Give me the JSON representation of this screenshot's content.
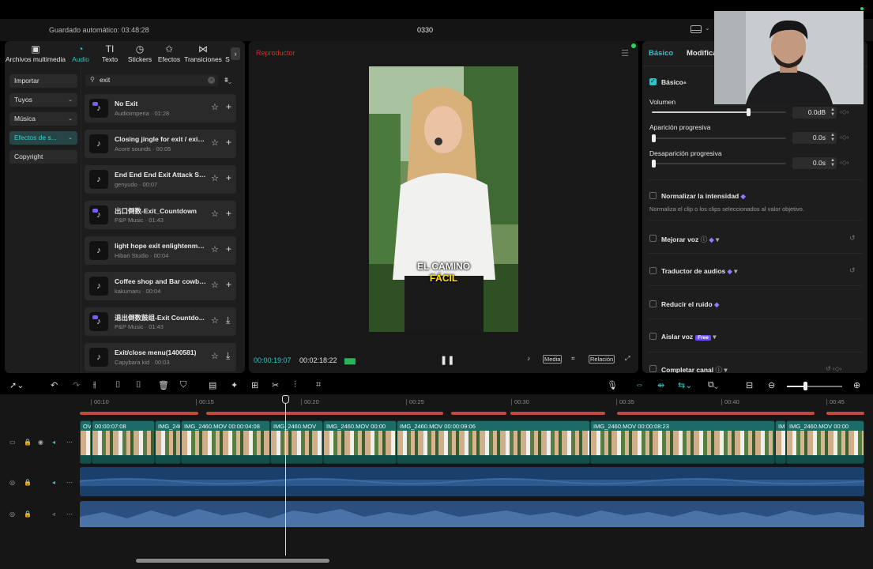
{
  "appbar": {
    "autosave": "Guardado automático: 03:48:28",
    "project": "0330"
  },
  "left_tabs": [
    {
      "label": "Archivos multimedia",
      "icon": "media-icon",
      "glyph": "▣"
    },
    {
      "label": "Audio",
      "icon": "audio-icon",
      "glyph": "◔"
    },
    {
      "label": "Texto",
      "icon": "text-icon",
      "glyph": "T͟I"
    },
    {
      "label": "Stickers",
      "icon": "sticker-icon",
      "glyph": "◷"
    },
    {
      "label": "Efectos",
      "icon": "effects-icon",
      "glyph": "✩"
    },
    {
      "label": "Transiciones",
      "icon": "transitions-icon",
      "glyph": "⋈"
    },
    {
      "label": "S",
      "icon": "more-tabs-icon",
      "glyph": ""
    }
  ],
  "categories": [
    {
      "label": "Importar",
      "caret": ""
    },
    {
      "label": "Tuyos",
      "caret": "⌄"
    },
    {
      "label": "Música",
      "caret": "⌄"
    },
    {
      "label": "Efectos de s...",
      "caret": "⌄"
    },
    {
      "label": "Copyright",
      "caret": ""
    }
  ],
  "search": {
    "value": "exit"
  },
  "tracks": [
    {
      "title": "No Exit",
      "meta": "Audioimperia · 01:28",
      "lib": true,
      "action": "+"
    },
    {
      "title": "Closing jingle for exit / exit(...",
      "meta": "Acore sounds · 00:05",
      "lib": false,
      "action": "+"
    },
    {
      "title": "End End End Exit Attack Sc...",
      "meta": "genyudo · 00:07",
      "lib": false,
      "action": "+"
    },
    {
      "title": "出口倒数-Exit_Countdown",
      "meta": "P&P Music · 01:43",
      "lib": true,
      "action": "+"
    },
    {
      "title": "light hope exit enlightenme...",
      "meta": "Hibari Studio · 00:04",
      "lib": false,
      "action": "+"
    },
    {
      "title": "Coffee shop and Bar cowbe...",
      "meta": "kakumaru · 00:04",
      "lib": false,
      "action": "+"
    },
    {
      "title": "退出倒数鼓组-Exit Countdo...",
      "meta": "P&P Music · 01:43",
      "lib": true,
      "action": "⤓"
    },
    {
      "title": "Exit/close menu(1400581)",
      "meta": "Capybara kid · 00:03",
      "lib": false,
      "action": "⤓"
    }
  ],
  "player": {
    "title": "Reproductor",
    "caption1": "EL CAMINO",
    "caption2": "FÁCIL",
    "current": "00:00:19:07",
    "total": "00:02:18:22",
    "media_btn": "Media",
    "ratio_btn": "Relación"
  },
  "right": {
    "tab_basic": "Básico",
    "tab_modify": "Modifica",
    "section": "Básico",
    "volume_label": "Volumen",
    "volume_value": "0.0dB",
    "volume_level": 0.72,
    "fadein_label": "Aparición progresiva",
    "fadein_value": "0.0s",
    "fadeout_label": "Desaparición progresiva",
    "fadeout_value": "0.0s",
    "normalize_label": "Normalizar la intensidad",
    "normalize_desc": "Normaliza el clip o los clips seleccionados al valor objetivo.",
    "enhance_label": "Mejorar voz",
    "translate_label": "Traductor de audios",
    "noise_label": "Reducir el ruido",
    "isolate_label": "Aislar voz",
    "free_badge": "Free",
    "channel_label": "Completar canal"
  },
  "timeline": {
    "ticks": [
      "00:10",
      "00:15",
      "00:20",
      "00:25",
      "00:30",
      "00:35",
      "00:40",
      "00:45"
    ],
    "clips": [
      {
        "label": "OV"
      },
      {
        "label": "00:00:07:08"
      },
      {
        "label": "IMG_246"
      },
      {
        "label": "IMG_2460.MOV  00:00:04:08"
      },
      {
        "label": "IMG_2460.MOV"
      },
      {
        "label": "IMG_2460.MOV  00:00"
      },
      {
        "label": "IMG_2460.MOV  00:00:09:06"
      },
      {
        "label": "IMG_2460.MOV  00:00:08:23"
      },
      {
        "label": "IM"
      },
      {
        "label": "IMG_2460.MOV  00:00"
      }
    ]
  },
  "colors": {
    "accent": "#2ec4c4",
    "record": "#e0242b",
    "clip": "#1b6b66",
    "audio": "#1b3f6b"
  }
}
